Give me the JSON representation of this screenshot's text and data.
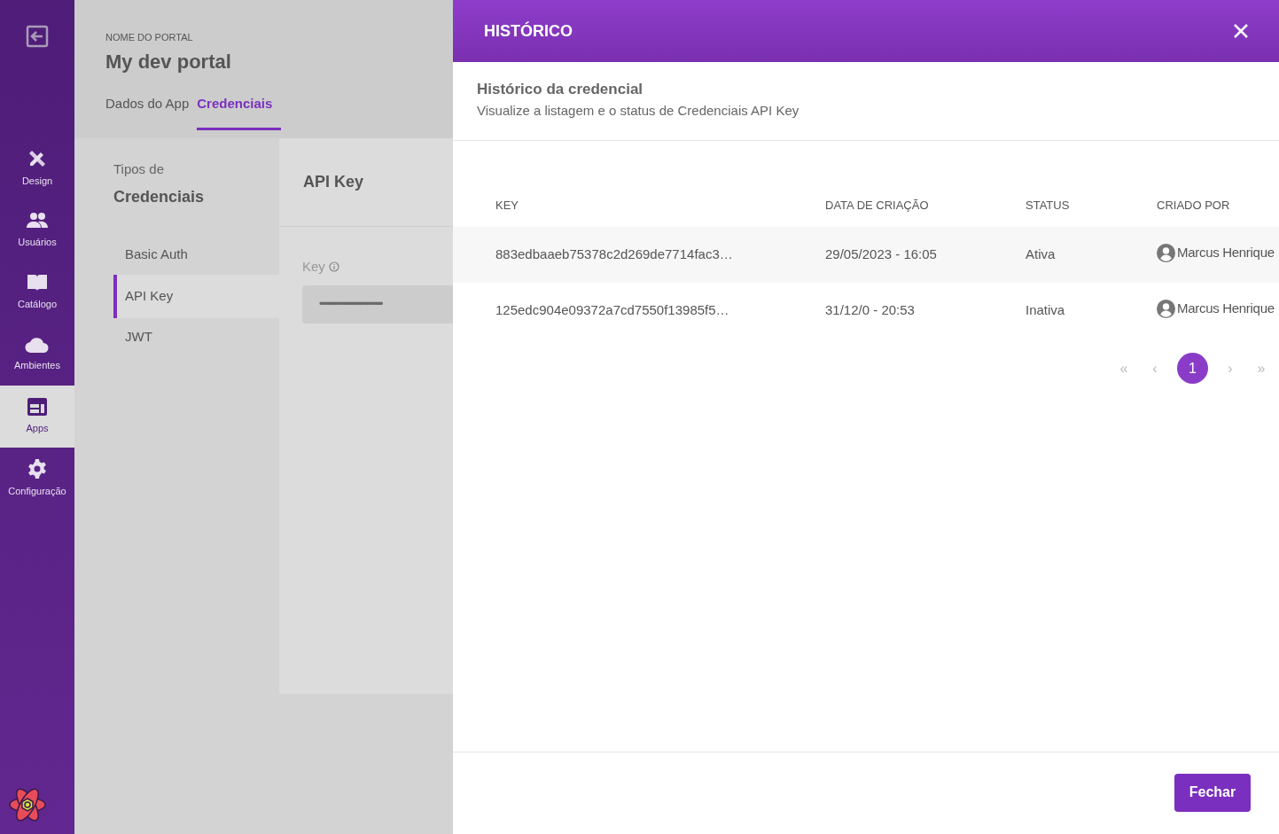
{
  "sidebar": {
    "items": [
      {
        "label": "Design",
        "kind": "design",
        "selected": false
      },
      {
        "label": "Usuários",
        "kind": "users",
        "selected": false
      },
      {
        "label": "Catálogo",
        "kind": "catalog",
        "selected": false
      },
      {
        "label": "Ambientes",
        "kind": "environments",
        "selected": false
      },
      {
        "label": "Apps",
        "kind": "apps",
        "selected": true
      },
      {
        "label": "Configuração",
        "kind": "settings",
        "selected": false
      }
    ]
  },
  "header": {
    "overline": "NOME DO PORTAL",
    "title": "My dev portal",
    "tabs": [
      {
        "label": "Dados do App",
        "selected": false
      },
      {
        "label": "Credenciais",
        "selected": true
      }
    ]
  },
  "credential_types": {
    "title_line1": "Tipos de",
    "title_line2": "Credenciais",
    "items": [
      {
        "label": "Basic Auth",
        "selected": false
      },
      {
        "label": "API Key",
        "selected": true
      },
      {
        "label": "JWT",
        "selected": false
      }
    ]
  },
  "detail": {
    "title": "API Key",
    "field_label": "Key",
    "field_value": "••••••••••••••••••••••••••••••••"
  },
  "drawer": {
    "title": "HISTÓRICO",
    "heading": "Histórico da credencial",
    "subtitle": "Visualize a listagem e o status de Credenciais API Key",
    "table": {
      "columns": [
        "KEY",
        "DATA DE CRIAÇÃO",
        "STATUS",
        "CRIADO POR"
      ],
      "rows": [
        {
          "key": "883edbaaeb75378c2d269de7714fac3…",
          "created": "29/05/2023 - 16:05",
          "status": "Ativa",
          "created_by": "Marcus Henrique"
        },
        {
          "key": "125edc904e09372a7cd7550f13985f5…",
          "created": "31/12/0 - 20:53",
          "status": "Inativa",
          "created_by": "Marcus Henrique"
        }
      ]
    },
    "pagination": {
      "first": "«",
      "prev": "‹",
      "pages": [
        {
          "label": "1",
          "selected": true
        }
      ],
      "next": "›",
      "last": "»"
    },
    "close_button": "Fechar"
  }
}
